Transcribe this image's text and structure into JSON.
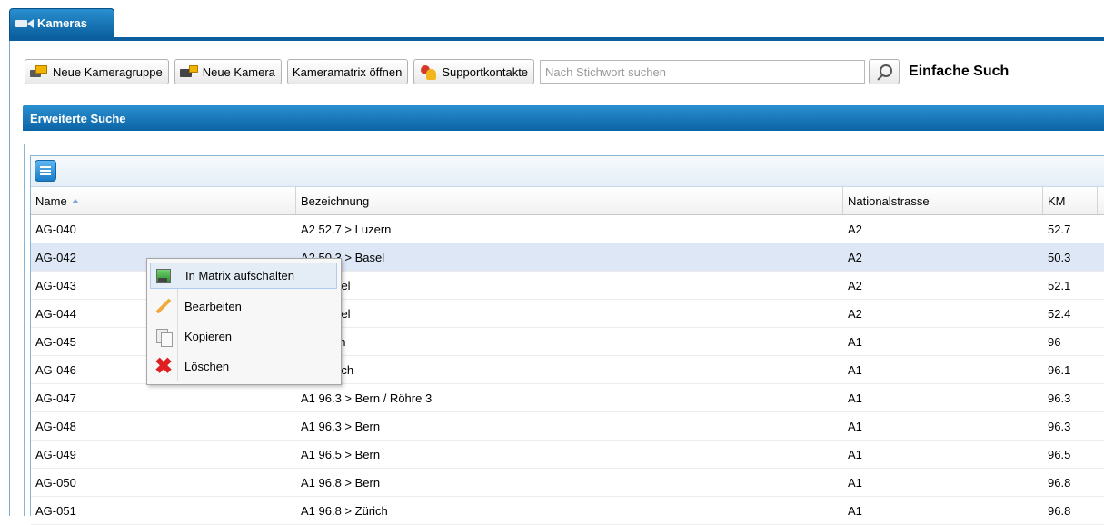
{
  "tab": {
    "label": "Kameras"
  },
  "toolbar": {
    "new_group": "Neue Kameragruppe",
    "new_camera": "Neue Kamera",
    "open_matrix": "Kameramatrix öffnen",
    "support": "Supportkontakte",
    "search_placeholder": "Nach Stichwort suchen",
    "simple_search": "Einfache Such"
  },
  "advanced_search": {
    "label": "Erweiterte Suche"
  },
  "grid": {
    "columns": [
      "Name",
      "Bezeichnung",
      "Nationalstrasse",
      "KM"
    ],
    "sort": "ascending",
    "rows": [
      {
        "name": "AG-040",
        "bezeichnung": "A2 52.7 > Luzern",
        "strasse": "A2",
        "km": "52.7"
      },
      {
        "name": "AG-042",
        "bezeichnung": "A2 50.3 > Basel",
        "strasse": "A2",
        "km": "50.3"
      },
      {
        "name": "AG-043",
        "bezeichnung": "1 > Basel",
        "strasse": "A2",
        "km": "52.1"
      },
      {
        "name": "AG-044",
        "bezeichnung": "4 > Basel",
        "strasse": "A2",
        "km": "52.4"
      },
      {
        "name": "AG-045",
        "bezeichnung": "1 > Bern",
        "strasse": "A1",
        "km": "96"
      },
      {
        "name": "AG-046",
        "bezeichnung": "1 > Zürich",
        "strasse": "A1",
        "km": "96.1"
      },
      {
        "name": "AG-047",
        "bezeichnung": "A1 96.3 > Bern / Röhre 3",
        "strasse": "A1",
        "km": "96.3"
      },
      {
        "name": "AG-048",
        "bezeichnung": "A1 96.3 > Bern",
        "strasse": "A1",
        "km": "96.3"
      },
      {
        "name": "AG-049",
        "bezeichnung": "A1 96.5 > Bern",
        "strasse": "A1",
        "km": "96.5"
      },
      {
        "name": "AG-050",
        "bezeichnung": "A1 96.8 > Bern",
        "strasse": "A1",
        "km": "96.8"
      },
      {
        "name": "AG-051",
        "bezeichnung": "A1 96.8 > Zürich",
        "strasse": "A1",
        "km": "96.8"
      }
    ]
  },
  "context_menu": {
    "items": [
      {
        "label": "In Matrix aufschalten",
        "icon": "matrix-icon"
      },
      {
        "label": "Bearbeiten",
        "icon": "pencil-icon"
      },
      {
        "label": "Kopieren",
        "icon": "copy-icon"
      },
      {
        "label": "Löschen",
        "icon": "delete-icon"
      }
    ]
  }
}
